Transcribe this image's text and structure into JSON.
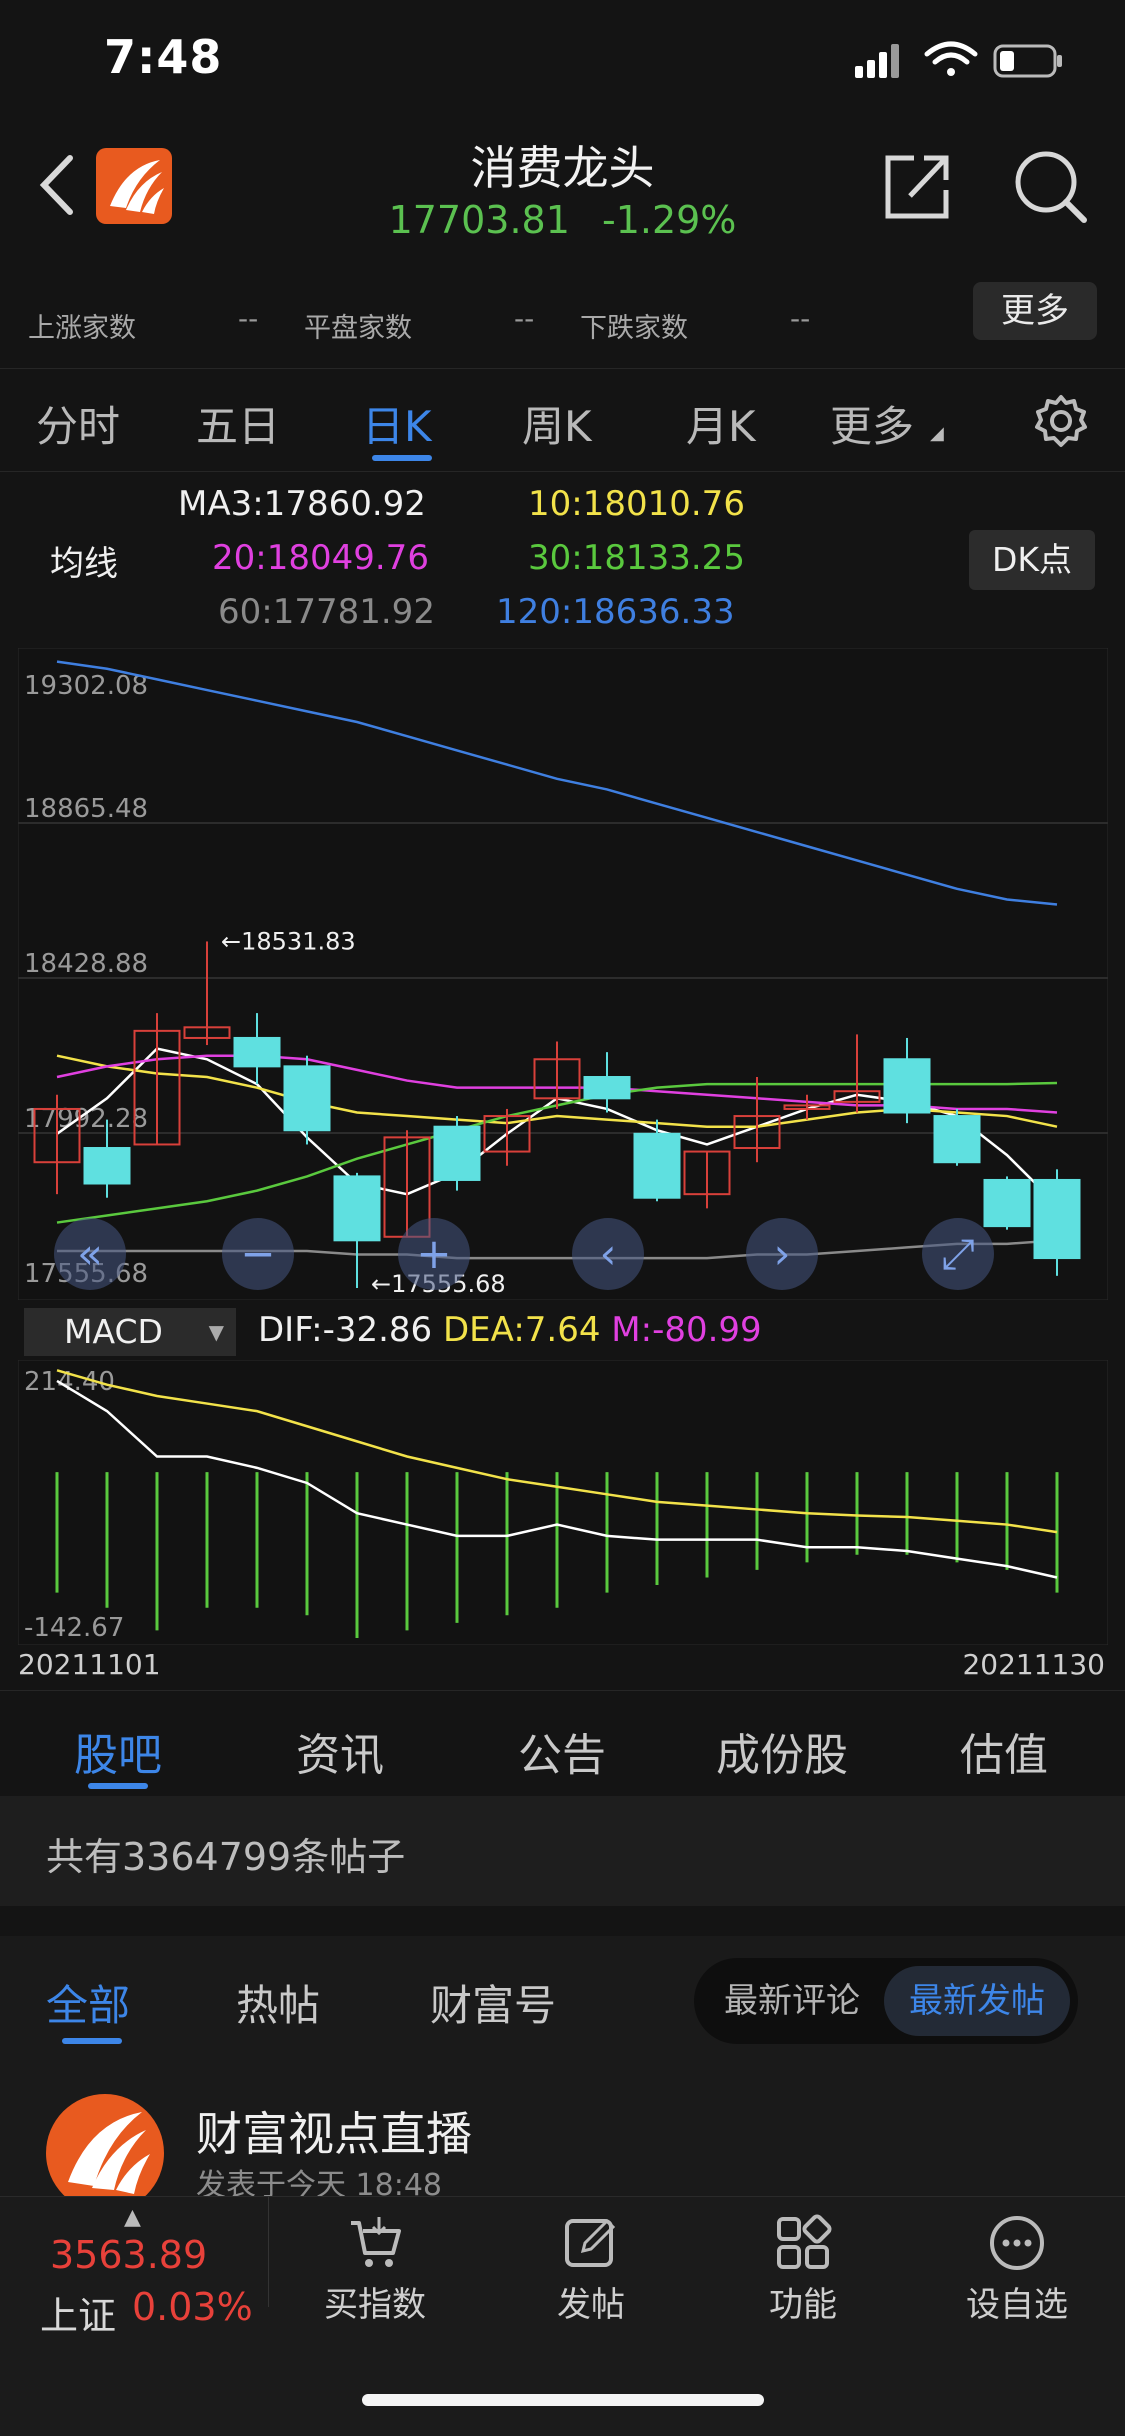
{
  "status": {
    "time": "7:48"
  },
  "header": {
    "title": "消费龙头",
    "price": "17703.81",
    "change_pct": "-1.29%"
  },
  "stats": {
    "up_label": "上涨家数",
    "up_value": "--",
    "flat_label": "平盘家数",
    "flat_value": "--",
    "down_label": "下跌家数",
    "down_value": "--",
    "more_label": "更多"
  },
  "kline_tabs": [
    "分时",
    "五日",
    "日K",
    "周K",
    "月K",
    "更多"
  ],
  "active_kline_tab": "日K",
  "ma": {
    "label": "均线",
    "ma3": "MA3:17860.92",
    "ma10": "10:18010.76",
    "ma20": "20:18049.76",
    "ma30": "30:18133.25",
    "ma60": "60:17781.92",
    "ma120": "120:18636.33",
    "dk_label": "DK点",
    "colors": {
      "ma3": "#ffffff",
      "ma10": "#f2e24a",
      "ma20": "#e040e0",
      "ma30": "#5ac93e",
      "ma60": "#8a8a8a",
      "ma120": "#3f7fe0"
    }
  },
  "macd": {
    "selector": "MACD",
    "dif": "DIF:-32.86",
    "dea": "DEA:7.64",
    "m": "M:-80.99",
    "top_label": "214.40",
    "bottom_label": "-142.67"
  },
  "dates": {
    "start": "20211101",
    "end": "20211130"
  },
  "chart_data": [
    {
      "type": "candlestick",
      "title": "",
      "y_labels": [
        "19302.08",
        "18865.48",
        "18428.88",
        "17992.28",
        "17555.68"
      ],
      "ylim": [
        17555.68,
        19302.08
      ],
      "high_annotation": "18531.83",
      "low_annotation": "17555.68",
      "candles": [
        {
          "o": 17910,
          "c": 18060,
          "h": 18100,
          "l": 17820,
          "dir": "up"
        },
        {
          "o": 17950,
          "c": 17850,
          "h": 18030,
          "l": 17810,
          "dir": "down"
        },
        {
          "o": 17960,
          "c": 18280,
          "h": 18330,
          "l": 17960,
          "dir": "up"
        },
        {
          "o": 18260,
          "c": 18290,
          "h": 18531.83,
          "l": 18240,
          "dir": "up"
        },
        {
          "o": 18260,
          "c": 18180,
          "h": 18330,
          "l": 18130,
          "dir": "down"
        },
        {
          "o": 18180,
          "c": 18000,
          "h": 18210,
          "l": 17960,
          "dir": "down"
        },
        {
          "o": 17870,
          "c": 17690,
          "h": 17880,
          "l": 17555.68,
          "dir": "down"
        },
        {
          "o": 17700,
          "c": 17980,
          "h": 18000,
          "l": 17700,
          "dir": "up"
        },
        {
          "o": 18010,
          "c": 17860,
          "h": 18040,
          "l": 17830,
          "dir": "down"
        },
        {
          "o": 17940,
          "c": 18040,
          "h": 18060,
          "l": 17900,
          "dir": "up"
        },
        {
          "o": 18090,
          "c": 18200,
          "h": 18250,
          "l": 18060,
          "dir": "up"
        },
        {
          "o": 18150,
          "c": 18090,
          "h": 18220,
          "l": 18050,
          "dir": "down"
        },
        {
          "o": 17990,
          "c": 17810,
          "h": 18030,
          "l": 17800,
          "dir": "down"
        },
        {
          "o": 17820,
          "c": 17940,
          "h": 17940,
          "l": 17780,
          "dir": "up"
        },
        {
          "o": 17950,
          "c": 18040,
          "h": 18150,
          "l": 17910,
          "dir": "up"
        },
        {
          "o": 18060,
          "c": 18070,
          "h": 18100,
          "l": 18030,
          "dir": "up"
        },
        {
          "o": 18080,
          "c": 18110,
          "h": 18270,
          "l": 18050,
          "dir": "up"
        },
        {
          "o": 18200,
          "c": 18050,
          "h": 18260,
          "l": 18020,
          "dir": "down"
        },
        {
          "o": 18040,
          "c": 17910,
          "h": 18060,
          "l": 17900,
          "dir": "down"
        },
        {
          "o": 17860,
          "c": 17730,
          "h": 17870,
          "l": 17720,
          "dir": "down"
        },
        {
          "o": 17860,
          "c": 17640,
          "h": 17890,
          "l": 17590,
          "dir": "down"
        }
      ],
      "series": [
        {
          "name": "MA3",
          "values": [
            17990,
            18090,
            18230,
            18200,
            18130,
            17980,
            17850,
            17820,
            17880,
            17990,
            18090,
            18060,
            18000,
            17960,
            18010,
            18060,
            18100,
            18080,
            18040,
            17930,
            17790
          ]
        },
        {
          "name": "MA10",
          "values": [
            18210,
            18180,
            18160,
            18150,
            18120,
            18080,
            18050,
            18040,
            18030,
            18020,
            18040,
            18030,
            18020,
            18010,
            18010,
            18030,
            18050,
            18060,
            18050,
            18040,
            18010
          ]
        },
        {
          "name": "MA20",
          "values": [
            18150,
            18180,
            18200,
            18210,
            18210,
            18200,
            18170,
            18140,
            18120,
            18120,
            18120,
            18120,
            18110,
            18100,
            18090,
            18080,
            18070,
            18070,
            18060,
            18060,
            18050
          ]
        },
        {
          "name": "MA30",
          "values": [
            17740,
            17760,
            17780,
            17800,
            17830,
            17870,
            17920,
            17960,
            18000,
            18040,
            18070,
            18100,
            18120,
            18130,
            18130,
            18130,
            18130,
            18130,
            18130,
            18130,
            18133
          ]
        },
        {
          "name": "MA60",
          "values": [
            17660,
            17660,
            17660,
            17660,
            17660,
            17660,
            17650,
            17650,
            17640,
            17640,
            17640,
            17640,
            17640,
            17640,
            17650,
            17650,
            17660,
            17670,
            17680,
            17680,
            17690
          ]
        },
        {
          "name": "MA120",
          "values": [
            19320,
            19300,
            19270,
            19240,
            19210,
            19180,
            19150,
            19110,
            19070,
            19030,
            18990,
            18960,
            18920,
            18880,
            18840,
            18800,
            18760,
            18720,
            18680,
            18650,
            18636
          ]
        }
      ]
    },
    {
      "type": "line",
      "title": "",
      "ylim": [
        -142.67,
        214.4
      ],
      "series": [
        {
          "name": "DIF",
          "values": [
            200,
            160,
            100,
            100,
            85,
            65,
            25,
            10,
            -5,
            -5,
            10,
            -5,
            -10,
            -10,
            -10,
            -20,
            -20,
            -25,
            -35,
            -45,
            -60
          ]
        },
        {
          "name": "DEA",
          "values": [
            214,
            195,
            180,
            170,
            160,
            140,
            120,
            100,
            85,
            70,
            60,
            50,
            40,
            35,
            30,
            25,
            22,
            20,
            15,
            10,
            0
          ]
        },
        {
          "name": "M",
          "values": [
            -80,
            -100,
            -130,
            -100,
            -100,
            -110,
            -140,
            -130,
            -120,
            -110,
            -100,
            -80,
            -70,
            -60,
            -50,
            -40,
            -30,
            -30,
            -40,
            -50,
            -80
          ]
        }
      ]
    }
  ],
  "section_tabs": [
    "股吧",
    "资讯",
    "公告",
    "成份股",
    "估值"
  ],
  "post_count": "共有3364799条帖子",
  "filters": {
    "tabs": [
      "全部",
      "热帖",
      "财富号"
    ],
    "sort_options": [
      "最新评论",
      "最新发帖"
    ]
  },
  "post": {
    "author": "财富视点直播",
    "time": "发表于今天 18:48"
  },
  "bottom": {
    "index_value": "3563.89",
    "index_name": "上证",
    "index_pct": "0.03%",
    "items": [
      "买指数",
      "发帖",
      "功能",
      "设自选"
    ]
  }
}
